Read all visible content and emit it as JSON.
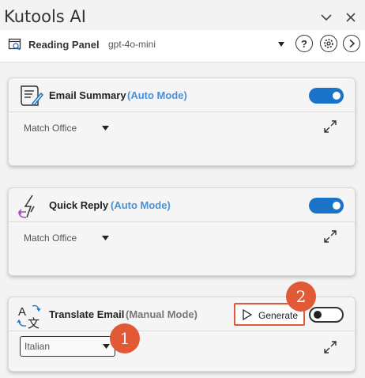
{
  "app": {
    "title": "Kutools AI"
  },
  "toolbar": {
    "panel_label": "Reading Panel",
    "model": "gpt-4o-mini",
    "icons": [
      "reading-panel-icon",
      "help-icon",
      "settings-icon",
      "forward-icon"
    ]
  },
  "cards": [
    {
      "title": "Email Summary",
      "mode": "(Auto Mode)",
      "enabled": true,
      "selected_option": "Match Office",
      "icon": "email-summary-icon"
    },
    {
      "title": "Quick Reply",
      "mode": "(Auto Mode)",
      "enabled": true,
      "selected_option": "Match Office",
      "icon": "quick-reply-icon"
    },
    {
      "title": "Translate Email",
      "mode": "(Manual Mode)",
      "enabled": false,
      "selected_option": "Italian",
      "generate_label": "Generate",
      "icon": "translate-icon"
    }
  ],
  "callouts": {
    "one": "1",
    "two": "2"
  },
  "colors": {
    "accent": "#1a73c9",
    "mode_blue": "#4a90d9",
    "callout": "#e25a35"
  }
}
